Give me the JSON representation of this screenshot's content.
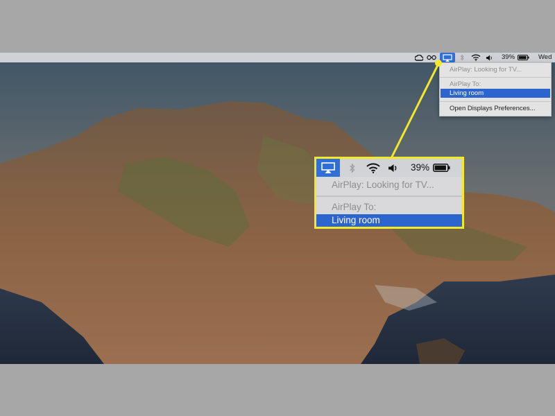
{
  "menubar": {
    "icons": [
      "creative-cloud-icon",
      "glasses-icon",
      "airplay-icon",
      "bluetooth-icon",
      "wifi-icon",
      "volume-icon",
      "battery-icon"
    ],
    "battery_percent": "39%",
    "battery_level": 0.39,
    "clock": "Wed"
  },
  "airplay_menu": {
    "status": "AirPlay: Looking for TV...",
    "section_label": "AirPlay To:",
    "device": "Living room",
    "open_prefs": "Open Displays Preferences..."
  },
  "zoom": {
    "battery_percent": "39%",
    "status": "AirPlay: Looking for TV...",
    "section_label": "AirPlay To:",
    "device": "Living room"
  },
  "colors": {
    "highlight": "#2d65cf",
    "callout": "#f3e92a",
    "menubar": "#cfd1d6"
  }
}
